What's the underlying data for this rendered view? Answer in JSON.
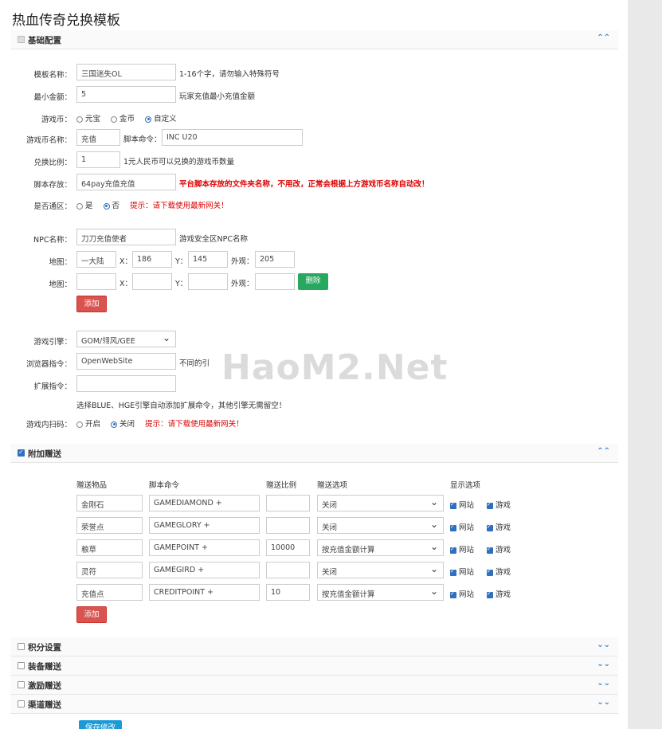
{
  "title": "热血传奇兑换模板",
  "sections": {
    "basic": {
      "label": "基础配置",
      "chevron": "⌃⌃"
    },
    "extra": {
      "label": "附加赠送",
      "chevron": "⌃⌃"
    },
    "points": {
      "label": "积分设置",
      "chevron": "⌄⌄"
    },
    "equip": {
      "label": "装备赠送",
      "chevron": "⌄⌄"
    },
    "incentive": {
      "label": "激励赠送",
      "chevron": "⌄⌄"
    },
    "channel": {
      "label": "渠道赠送",
      "chevron": "⌄⌄"
    }
  },
  "form": {
    "template_name": {
      "label": "模板名称：",
      "value": "三国迷失OL",
      "hint": "1-16个字，请勿输入特殊符号"
    },
    "min_amount": {
      "label": "最小金额：",
      "value": "5",
      "hint": "玩家充值最小充值金额"
    },
    "currency": {
      "label": "游戏币：",
      "options": [
        "元宝",
        "金币",
        "自定义"
      ],
      "selected": "自定义"
    },
    "currency_name": {
      "label": "游戏币名称：",
      "value": "充值",
      "script_label": "脚本命令：",
      "script_value": "INC U20"
    },
    "ratio": {
      "label": "兑换比例：",
      "value": "1",
      "hint": "1元人民币可以兑换的游戏币数量"
    },
    "script_store": {
      "label": "脚本存放：",
      "value": "64pay充值充值",
      "hint": "平台脚本存放的文件夹名称，不用改，正常会根据上方游戏币名称自动改！"
    },
    "merged": {
      "label": "是否通区：",
      "options": [
        "是",
        "否"
      ],
      "selected": "否",
      "tip": "提示：请下载使用最新网关！"
    },
    "npc_name": {
      "label": "NPC名称：",
      "value": "刀刀充值使者",
      "hint": "游戏安全区NPC名称"
    },
    "map_rows": [
      {
        "label": "地图：",
        "map": "一大陆",
        "x": "186",
        "y": "145",
        "look": "205"
      },
      {
        "label": "地图：",
        "map": "",
        "x": "",
        "y": "",
        "look": "",
        "delete": "删除"
      }
    ],
    "x_label": "X：",
    "y_label": "Y：",
    "look_label": "外观：",
    "add_label": "添加",
    "engine": {
      "label": "游戏引擎：",
      "value": "GOM/翎风/GEE"
    },
    "browser_cmd": {
      "label": "浏览器指令：",
      "value": "OpenWebSite",
      "hint": "不同的引"
    },
    "ext_cmd": {
      "label": "扩展指令：",
      "value": ""
    },
    "ext_hint": "选择BLUE、HGE引擎自动添加扩展命令，其他引擎无需留空！",
    "qr": {
      "label": "游戏内扫码：",
      "options": [
        "开启",
        "关闭"
      ],
      "selected": "关闭",
      "tip": "提示：请下载使用最新网关！"
    }
  },
  "extra_table": {
    "headers": [
      "赠送物品",
      "脚本命令",
      "赠送比例",
      "赠送选项",
      "显示选项"
    ],
    "rows": [
      {
        "item": "金刚石",
        "cmd": "GAMEDIAMOND +",
        "ratio": "",
        "option": "关闭",
        "site": "网站",
        "game": "游戏"
      },
      {
        "item": "荣誉点",
        "cmd": "GAMEGLORY +",
        "ratio": "",
        "option": "关闭",
        "site": "网站",
        "game": "游戏"
      },
      {
        "item": "粮草",
        "cmd": "GAMEPOINT +",
        "ratio": "10000",
        "option": "按充值金额计算",
        "site": "网站",
        "game": "游戏"
      },
      {
        "item": "灵符",
        "cmd": "GAMEGIRD +",
        "ratio": "",
        "option": "关闭",
        "site": "网站",
        "game": "游戏"
      },
      {
        "item": "充值点",
        "cmd": "CREDITPOINT +",
        "ratio": "10",
        "option": "按充值金额计算",
        "site": "网站",
        "game": "游戏"
      }
    ],
    "add_label": "添加"
  },
  "save_label": "保存修改",
  "watermark": "HaoM2.Net"
}
